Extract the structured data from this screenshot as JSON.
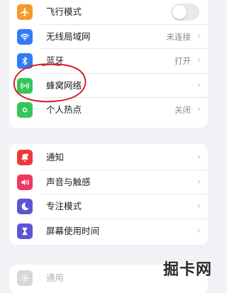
{
  "colors": {
    "airplane": "#f39a2b",
    "wifi": "#2f7cf6",
    "bluetooth": "#2f7cf6",
    "cellular": "#35c659",
    "hotspot": "#35c659",
    "notifications": "#f0383b",
    "sounds": "#f0385f",
    "focus": "#5b55d6",
    "screen_time": "#5b55d6",
    "general": "#8e8e93",
    "annotation": "#d7202b"
  },
  "group1": {
    "items": [
      {
        "label": "飞行模式",
        "icon": "airplane-icon",
        "toggle_on": false
      },
      {
        "label": "无线局域网",
        "icon": "wifi-icon",
        "value": "未连接"
      },
      {
        "label": "蓝牙",
        "icon": "bluetooth-icon",
        "value": "打开"
      },
      {
        "label": "蜂窝网络",
        "icon": "cellular-icon",
        "value": ""
      },
      {
        "label": "个人热点",
        "icon": "hotspot-icon",
        "value": "关闭"
      }
    ]
  },
  "group2": {
    "items": [
      {
        "label": "通知",
        "icon": "bell-icon"
      },
      {
        "label": "声音与触感",
        "icon": "speaker-icon"
      },
      {
        "label": "专注模式",
        "icon": "moon-icon"
      },
      {
        "label": "屏幕使用时间",
        "icon": "hourglass-icon"
      }
    ]
  },
  "group3": {
    "items": [
      {
        "label": "通用",
        "icon": "gear-icon"
      }
    ]
  },
  "chevron": "›",
  "watermark": "掘卡网"
}
